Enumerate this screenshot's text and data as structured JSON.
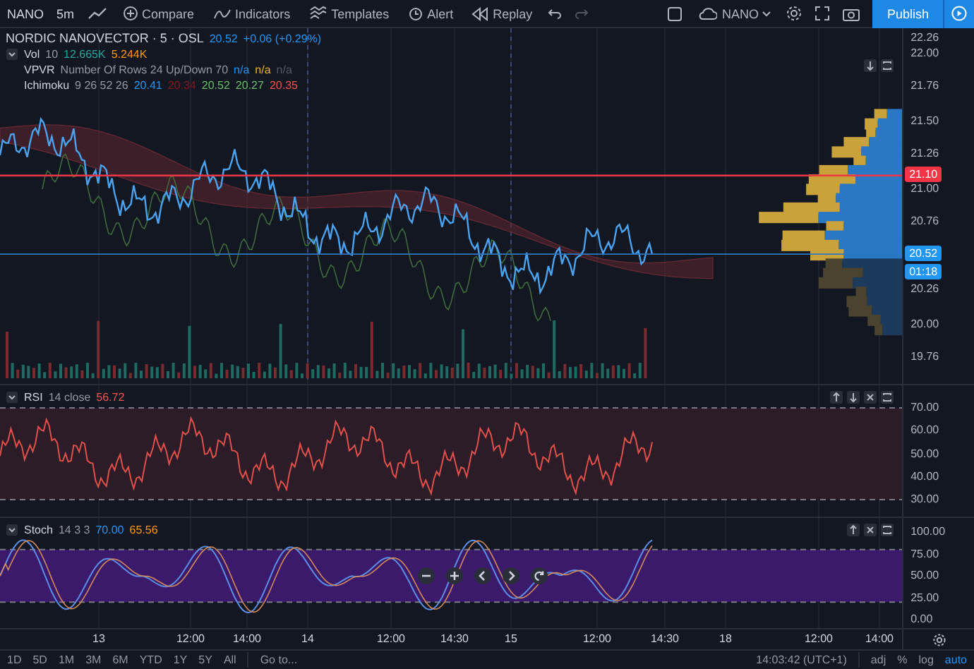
{
  "toolbar": {
    "symbol": "NANO",
    "interval": "5m",
    "buttons": [
      {
        "kind": "compare",
        "label": "Compare"
      },
      {
        "kind": "indicators",
        "label": "Indicators"
      },
      {
        "kind": "templates",
        "label": "Templates"
      },
      {
        "kind": "alert",
        "label": "Alert"
      },
      {
        "kind": "replay",
        "label": "Replay"
      }
    ],
    "layout_name": "NANO",
    "publish": "Publish"
  },
  "legend": {
    "title": "NORDIC NANOVECTOR · 5 · OSL",
    "price": "20.52",
    "change": "+0.06 (+0.29%)",
    "indicators": [
      {
        "name": "Vol",
        "params": "10",
        "values": [
          {
            "text": "12.665K",
            "color": "#26a69a"
          },
          {
            "text": "5.244K",
            "color": "#ff9800"
          }
        ]
      },
      {
        "name": "VPVR",
        "params": "Number Of Rows 24 Up/Down 70",
        "values": [
          {
            "text": "n/a",
            "color": "#2196f3"
          },
          {
            "text": "n/a",
            "color": "#e6b422"
          },
          {
            "text": "n/a",
            "color": "#555a66"
          }
        ]
      },
      {
        "name": "Ichimoku",
        "params": "9 26 52 26",
        "values": [
          {
            "text": "20.41",
            "color": "#2196f3"
          },
          {
            "text": "20.34",
            "color": "#801922"
          },
          {
            "text": "20.52",
            "color": "#66bb6a"
          },
          {
            "text": "20.27",
            "color": "#66bb6a"
          },
          {
            "text": "20.35",
            "color": "#ef5350"
          }
        ]
      }
    ]
  },
  "price_axis": [
    "22.26",
    "22.00",
    "21.76",
    "21.50",
    "21.26",
    "21.00",
    "20.76",
    "20.26",
    "20.00",
    "19.76"
  ],
  "price_labels": [
    {
      "text": "21.10",
      "color": "#f23645"
    },
    {
      "text": "20.52",
      "color": "#2196f3"
    },
    {
      "text": "01:18",
      "color": "#2196f3"
    }
  ],
  "rsi": {
    "name": "RSI",
    "params": "14 close",
    "value": "56.72",
    "axis": [
      "70.00",
      "60.00",
      "50.00",
      "40.00",
      "30.00"
    ]
  },
  "stoch": {
    "name": "Stoch",
    "params": "14 3 3",
    "values": [
      {
        "text": "70.00",
        "color": "#2196f3"
      },
      {
        "text": "65.56",
        "color": "#ff9800"
      }
    ],
    "axis": [
      "100.00",
      "75.00",
      "50.00",
      "25.00",
      "0.00"
    ]
  },
  "time_axis": [
    "13",
    "12:00",
    "14:00",
    "14",
    "12:00",
    "14:30",
    "15",
    "12:00",
    "14:30",
    "18",
    "12:00",
    "14:00"
  ],
  "bottom_bar": {
    "ranges": [
      "1D",
      "5D",
      "1M",
      "3M",
      "6M",
      "YTD",
      "1Y",
      "5Y",
      "All"
    ],
    "goto": "Go to...",
    "clock": "14:03:42 (UTC+1)",
    "options": [
      {
        "label": "adj",
        "selected": false
      },
      {
        "label": "%",
        "selected": false
      },
      {
        "label": "log",
        "selected": false
      },
      {
        "label": "auto",
        "selected": true
      }
    ]
  }
}
